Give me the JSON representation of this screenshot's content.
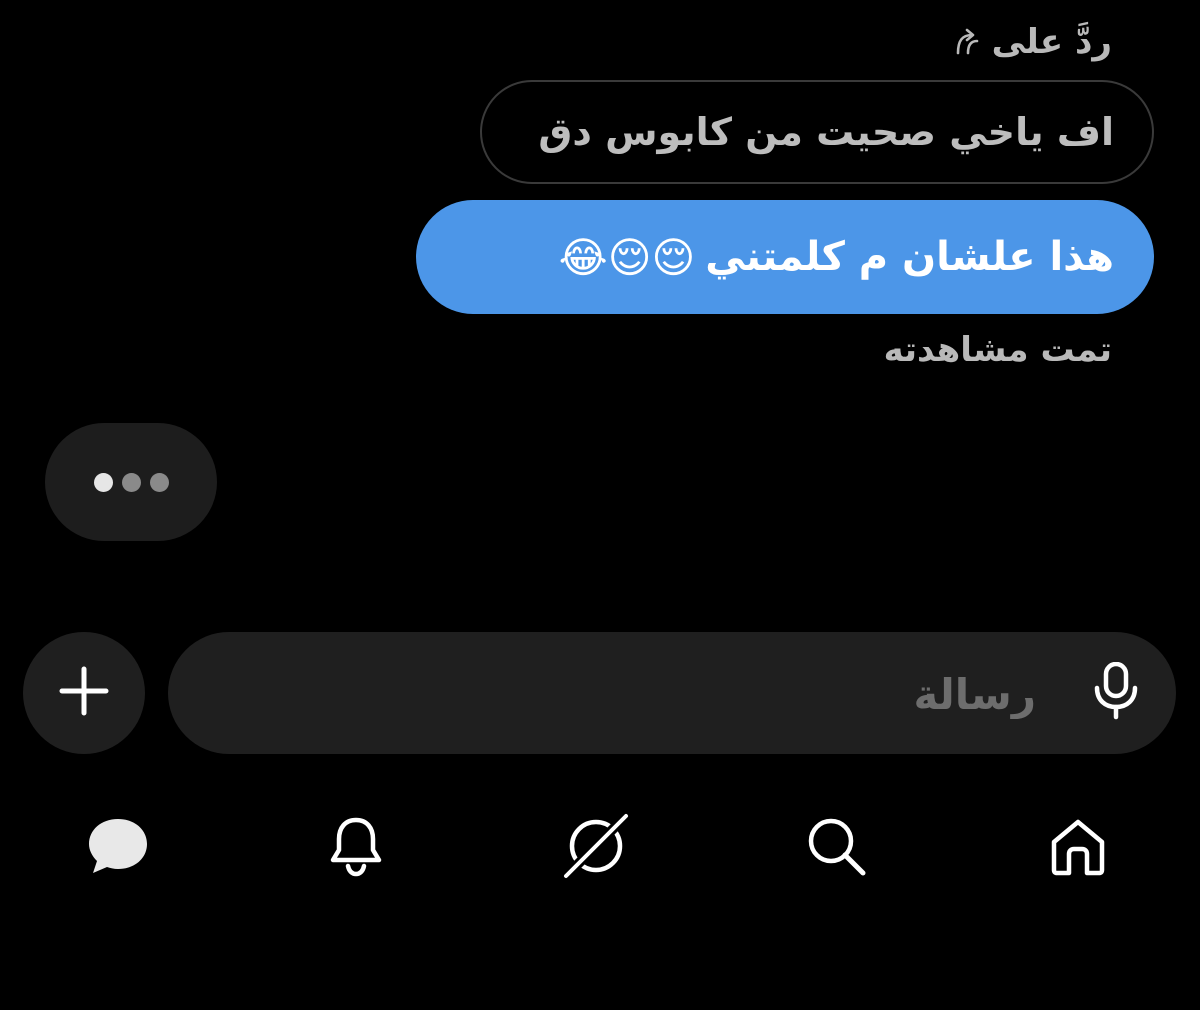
{
  "reply_header": {
    "label": "ردَّ على"
  },
  "quoted_message": {
    "text": "اف ياخي صحيت من كابوس دق"
  },
  "sent_message": {
    "text": "هذا علشان م كلمتني",
    "emojis": "😌😌😂"
  },
  "seen_status": {
    "text": "تمت مشاهدته"
  },
  "typing_indicator": {
    "dot_colors": [
      "#e6e6e6",
      "#8a8a8a",
      "#8a8a8a"
    ]
  },
  "composer": {
    "placeholder": "رسالة",
    "value": ""
  },
  "icons": {
    "reply": "reply-arrow-icon",
    "add": "plus-icon",
    "mic": "microphone-icon"
  },
  "bottom_nav": {
    "items": [
      {
        "icon": "messages-icon",
        "active": true
      },
      {
        "icon": "bell-icon",
        "active": false
      },
      {
        "icon": "compass-icon",
        "active": false
      },
      {
        "icon": "search-icon",
        "active": false
      },
      {
        "icon": "home-icon",
        "active": false
      }
    ]
  },
  "colors": {
    "background": "#000000",
    "sent_bubble": "#4c96e8",
    "surface": "#1f1f1f",
    "muted_text": "#b9b9b9"
  }
}
